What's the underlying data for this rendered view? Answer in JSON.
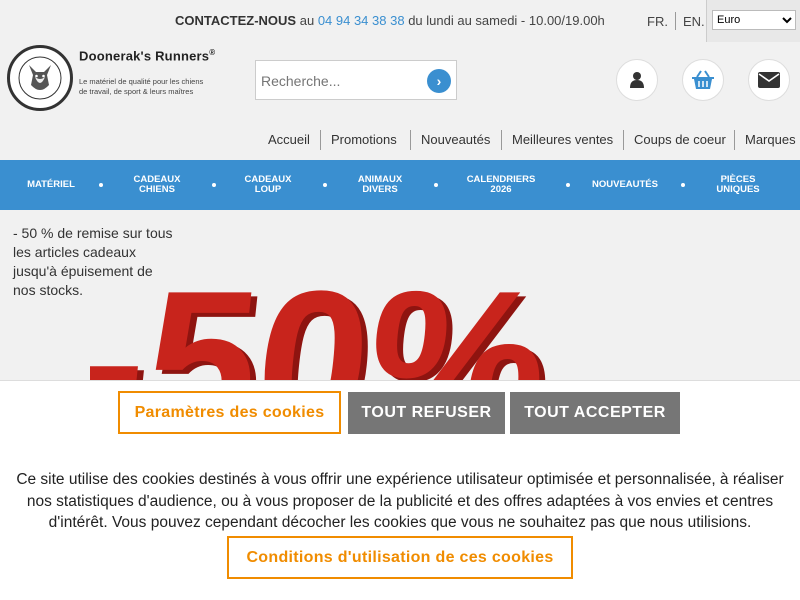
{
  "topbar": {
    "contact_label": "CONTACTEZ-NOUS",
    "contact_au": "au",
    "phone": "04 94 34 38 38",
    "hours": "du lundi au samedi - 10.00/19.00h",
    "lang_fr": "FR.",
    "lang_en": "EN.",
    "currency": "Euro"
  },
  "logo": {
    "badge_text": "DOONERAK'S RUNNERS",
    "title": "Doonerak's Runners",
    "registered": "®",
    "tagline": "Le matériel de qualité pour les chiens de travail, de sport & leurs maîtres"
  },
  "search": {
    "placeholder": "Recherche...",
    "go": "›"
  },
  "navlinks": [
    "Accueil",
    "Promotions",
    "Nouveautés",
    "Meilleures ventes",
    "Coups de coeur",
    "Marques"
  ],
  "categories": [
    "MATÉRIEL",
    "CADEAUX CHIENS",
    "CADEAUX LOUP",
    "ANIMAUX DIVERS",
    "CALENDRIERS 2026",
    "NOUVEAUTÉS",
    "PIÈCES UNIQUES"
  ],
  "promo": {
    "text": "- 50 % de remise sur tous les articles cadeaux jusqu'à épuisement de nos stocks.",
    "image_text": "-50%"
  },
  "cookie": {
    "params_label": "Paramètres des cookies",
    "refuse_label": "TOUT REFUSER",
    "accept_label": "TOUT ACCEPTER",
    "text": "Ce site utilise des cookies destinés à vous offrir une expérience utilisateur optimisée et personnalisée, à réaliser nos statistiques d'audience, ou à vous proposer de la publicité et des offres adaptées à vos envies et centres d'intérêt. Vous pouvez cependant décocher les cookies que vous ne souhaitez pas que nous utilisions.",
    "terms_label": "Conditions d'utilisation de ces cookies"
  },
  "colors": {
    "accent_blue": "#3a8fd0",
    "cookie_orange": "#f08c00",
    "button_gray": "#767676",
    "promo_red": "#c8241c"
  },
  "icons": [
    "search-go-icon",
    "user-icon",
    "basket-icon",
    "envelope-icon"
  ]
}
